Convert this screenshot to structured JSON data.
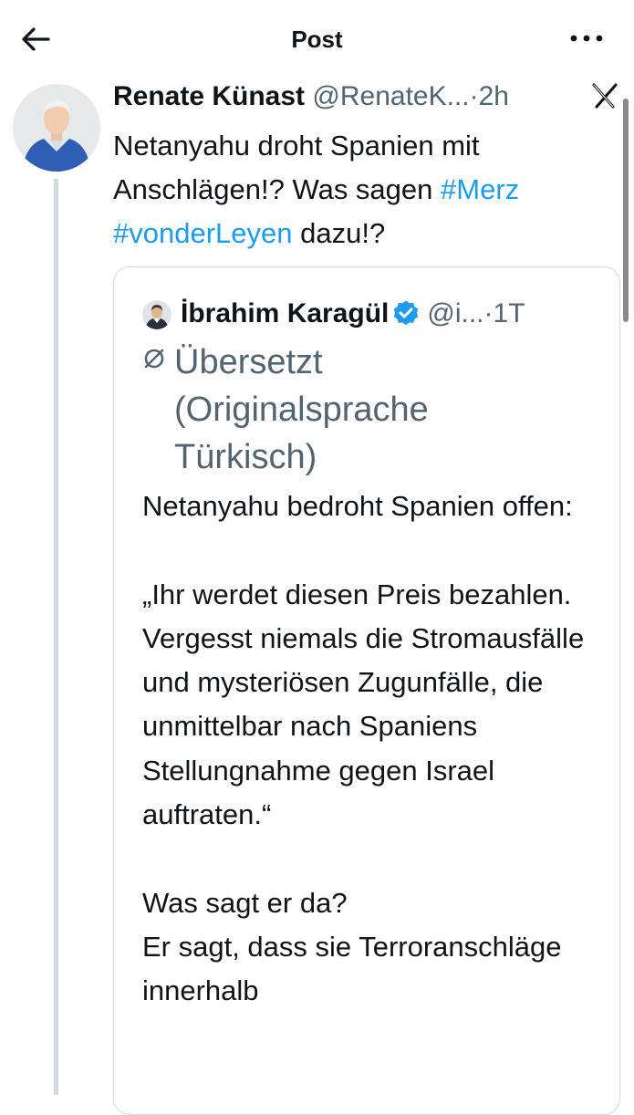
{
  "header": {
    "title": "Post"
  },
  "post": {
    "author_name": "Renate Künast",
    "handle": "@RenateK...",
    "separator": "·",
    "time": "2h",
    "text_plain_1": "Netanyahu droht Spanien mit Anschlägen!? Was sagen ",
    "hashtag_1": "#Merz",
    "text_plain_2": " ",
    "hashtag_2": "#vonderLeyen",
    "text_plain_3": " dazu!?"
  },
  "quoted_post": {
    "author_name": "İbrahim Karagül",
    "handle": "@i...",
    "separator": "·",
    "time": "1T",
    "translation_note": "Übersetzt (Originalsprache Türkisch)",
    "body": "Netanyahu bedroht Spanien offen:\n\n„Ihr werdet diesen Preis bezahlen. Vergesst niemals die Stromausfälle und mysteriösen Zugunfälle, die unmittelbar nach Spaniens Stellungnahme gegen Israel auftraten.“\n\nWas sagt er da?\nEr sagt, dass sie Terroranschläge innerhalb"
  },
  "icons": {
    "back": "arrow-left-icon",
    "more": "more-horizontal-icon",
    "platform": "x-logo-icon",
    "verified": "verified-badge-icon",
    "translate": "translate-icon"
  },
  "colors": {
    "link": "#1d9bf0",
    "muted": "#536471",
    "text": "#0f1419",
    "border": "#cfd9de"
  }
}
